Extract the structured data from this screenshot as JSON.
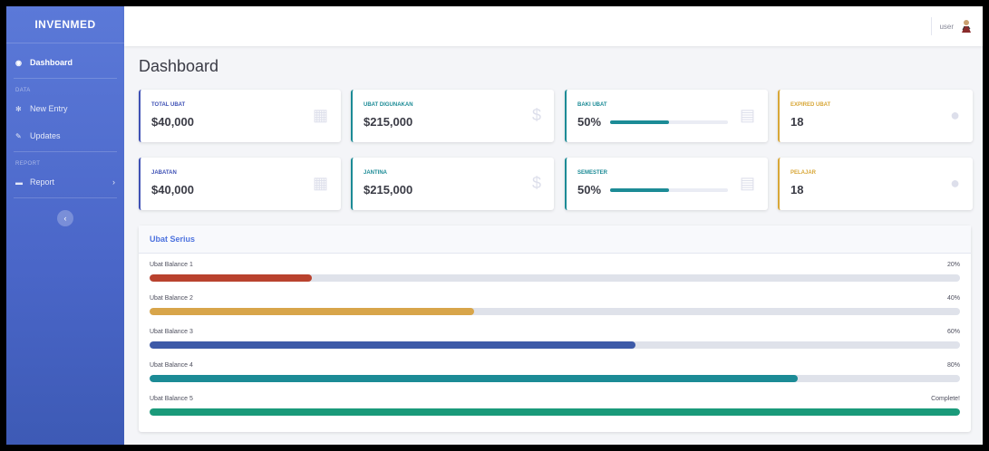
{
  "sidebar": {
    "brand": "INVENMED",
    "items": [
      {
        "label": "Dashboard",
        "icon": "tachometer-icon",
        "active": true
      },
      {
        "heading": "DATA"
      },
      {
        "label": "New Entry",
        "icon": "gear-icon"
      },
      {
        "label": "Updates",
        "icon": "wrench-icon"
      },
      {
        "heading": "REPORT"
      },
      {
        "label": "Report",
        "icon": "folder-icon"
      }
    ],
    "toggle": "‹"
  },
  "topbar": {
    "user": "user"
  },
  "page_title": "Dashboard",
  "cards": [
    {
      "label": "TOTAL UBAT",
      "value": "$40,000",
      "icon": "calendar-icon",
      "accent": "#3f51b5",
      "label_color": "#3f51b5"
    },
    {
      "label": "UBAT DIGUNAKAN",
      "value": "$215,000",
      "icon": "dollar-icon",
      "accent": "#1c8b96",
      "label_color": "#1c8b96"
    },
    {
      "label": "BAKI UBAT",
      "value": "50%",
      "icon": "clipboard-icon",
      "accent": "#1c8b96",
      "label_color": "#1c8b96",
      "progress": 0.5
    },
    {
      "label": "EXPIRED UBAT",
      "value": "18",
      "icon": "comments-icon",
      "accent": "#d8a738",
      "label_color": "#d8a738"
    },
    {
      "label": "JABATAN",
      "value": "$40,000",
      "icon": "calendar-icon",
      "accent": "#3f51b5",
      "label_color": "#3f51b5"
    },
    {
      "label": "JANTINA",
      "value": "$215,000",
      "icon": "dollar-icon",
      "accent": "#1c8b96",
      "label_color": "#1c8b96"
    },
    {
      "label": "SEMESTER",
      "value": "50%",
      "icon": "clipboard-icon",
      "accent": "#1c8b96",
      "label_color": "#1c8b96",
      "progress": 0.5
    },
    {
      "label": "PELAJAR",
      "value": "18",
      "icon": "comments-icon",
      "accent": "#d8a738",
      "label_color": "#d8a738"
    }
  ],
  "panel": {
    "title": "Ubat Serius",
    "rows": [
      {
        "label": "Ubat Balance 1",
        "value": "20%",
        "fraction": 0.2,
        "color": "#b9422e"
      },
      {
        "label": "Ubat Balance 2",
        "value": "40%",
        "fraction": 0.4,
        "color": "#d8a54a"
      },
      {
        "label": "Ubat Balance 3",
        "value": "60%",
        "fraction": 0.6,
        "color": "#3d5aa8"
      },
      {
        "label": "Ubat Balance 4",
        "value": "80%",
        "fraction": 0.8,
        "color": "#1c8b96"
      },
      {
        "label": "Ubat Balance 5",
        "value": "Complete!",
        "fraction": 1.0,
        "color": "#1a9a7a"
      }
    ]
  }
}
